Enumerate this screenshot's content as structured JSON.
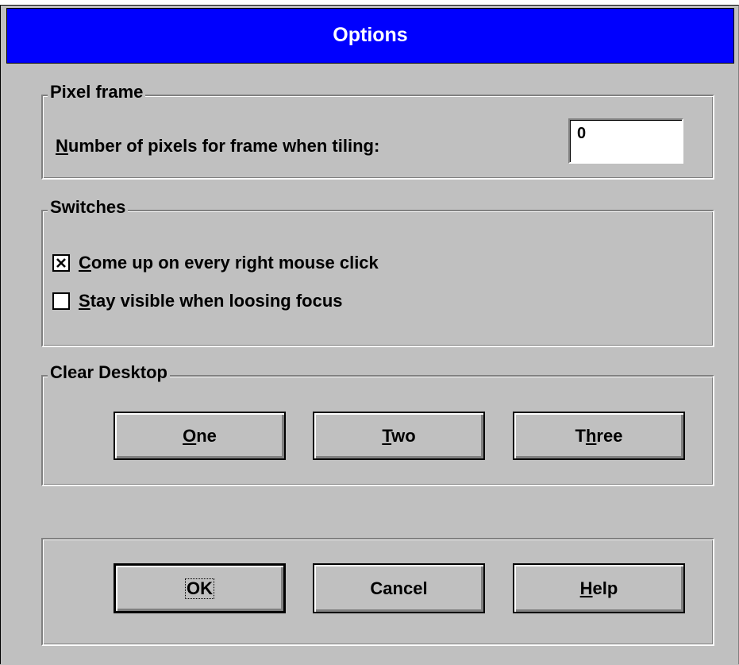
{
  "dialog": {
    "title": "Options"
  },
  "pixel_frame": {
    "group_label": "Pixel frame",
    "field_label": "Number of pixels for frame when tiling:",
    "value": "0"
  },
  "switches": {
    "group_label": "Switches",
    "items": [
      {
        "label": "Come up on every right mouse click",
        "checked": true
      },
      {
        "label": "Stay visible when loosing focus",
        "checked": false
      }
    ]
  },
  "clear_desktop": {
    "group_label": "Clear Desktop",
    "buttons": [
      "One",
      "Two",
      "Three"
    ]
  },
  "footer": {
    "ok_label": "OK",
    "cancel_label": "Cancel",
    "help_label": "Help"
  },
  "colors": {
    "titlebar": "#0000fe",
    "face": "#c0c0c0"
  }
}
